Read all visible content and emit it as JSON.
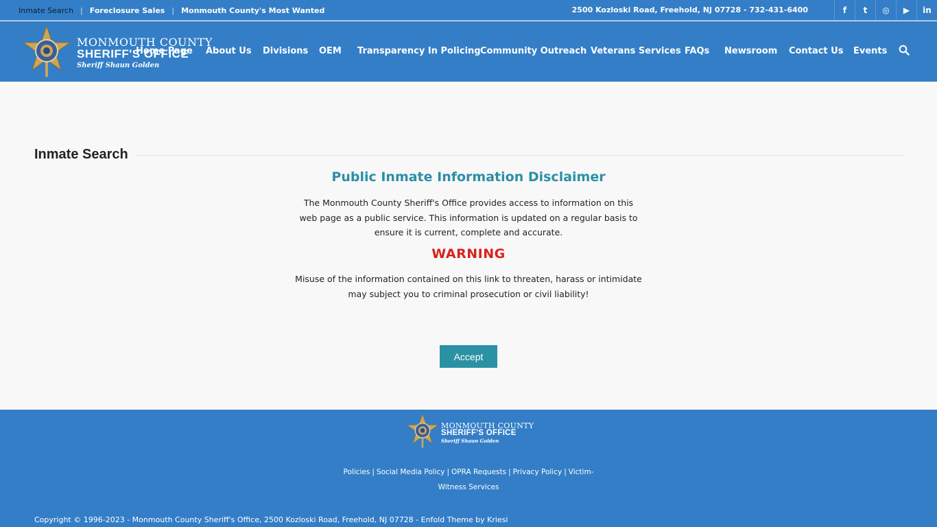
{
  "topbar": {
    "links": [
      "Inmate Search",
      "Foreclosure Sales",
      "Monmouth County's Most Wanted"
    ],
    "address": "2500 Kozloski Road, Freehold, NJ 07728 - 732-431-6400",
    "social": [
      "facebook-icon",
      "twitter-icon",
      "instagram-icon",
      "youtube-icon",
      "linkedin-icon"
    ],
    "social_glyphs": [
      "f",
      "t",
      "◎",
      "▶",
      "in"
    ]
  },
  "logo": {
    "line1": "MONMOUTH COUNTY",
    "line2": "SHERIFF'S OFFICE",
    "line3": "Sheriff Shaun Golden"
  },
  "nav": {
    "items": [
      "Home Page",
      "About Us",
      "Divisions",
      "OEM",
      "Transparency In Policing",
      "Community Outreach",
      "Veterans Services",
      "FAQs",
      "Newsroom",
      "Contact Us",
      "Events"
    ]
  },
  "main": {
    "section_title": "Inmate Search",
    "disclaimer_title": "Public Inmate Information Disclaimer",
    "paragraph1": "The Monmouth County Sheriff's Office provides access to information on this web page as a public service. This information is updated on a regular basis to ensure it is current, complete and accurate.",
    "warning": "WARNING",
    "paragraph2": "Misuse of the information contained on this link to threaten, harass or intimidate may subject you to criminal prosecution or civil liability!",
    "accept_label": "Accept"
  },
  "footer": {
    "links": [
      "Policies",
      "Social Media Policy",
      "OPRA Requests",
      "Privacy Policy",
      "Victim-Witness Services"
    ],
    "copyright": "Copyright © 1996-2023 - Monmouth County Sheriff's Office, 2500 Kozloski Road, Freehold, NJ 07728 - Enfold Theme by Kriesi"
  },
  "colors": {
    "brand_blue": "#337ec7",
    "disclaimer_teal": "#2b8fa8",
    "warning_red": "#d9221c",
    "button_teal": "#2a92a4"
  }
}
